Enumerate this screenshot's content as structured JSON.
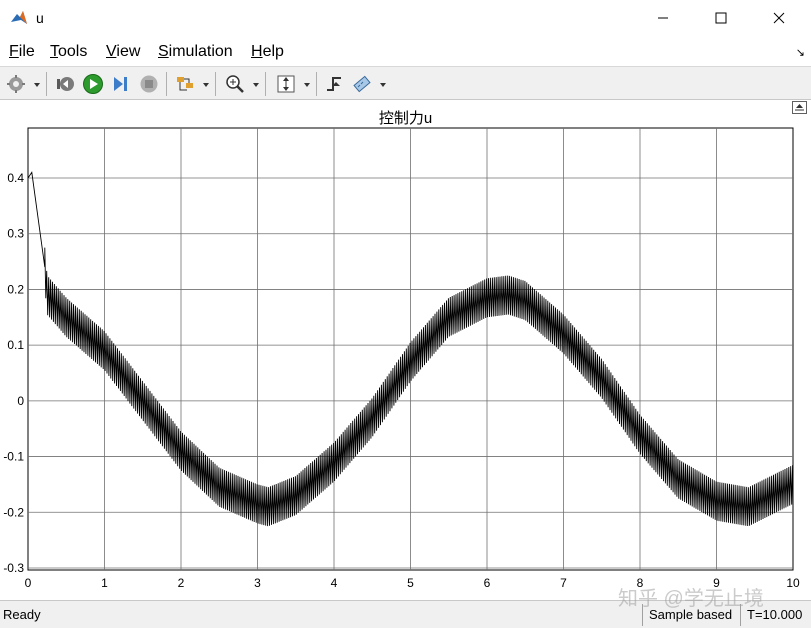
{
  "window": {
    "title": "u",
    "icon": "matlab-icon",
    "controls": [
      "minimize-icon",
      "maximize-icon",
      "close-icon"
    ]
  },
  "menu": {
    "items": [
      {
        "label": "File",
        "mnemonic": "F",
        "rest": "ile"
      },
      {
        "label": "Tools",
        "mnemonic": "T",
        "rest": "ools"
      },
      {
        "label": "View",
        "mnemonic": "V",
        "rest": "iew"
      },
      {
        "label": "Simulation",
        "mnemonic": "S",
        "rest": "imulation"
      },
      {
        "label": "Help",
        "mnemonic": "H",
        "rest": "elp"
      }
    ]
  },
  "toolbar": {
    "buttons": [
      "settings-icon",
      "step-back-icon",
      "run-icon",
      "step-forward-icon",
      "stop-icon",
      "signal-select-icon",
      "zoom-icon",
      "autoscale-icon",
      "triggers-icon",
      "cursor-measure-icon"
    ]
  },
  "chart_data": {
    "type": "line",
    "title": "控制力u",
    "xlabel": "",
    "ylabel": "",
    "xlim": [
      0,
      10
    ],
    "ylim": [
      -0.3,
      0.45
    ],
    "x_ticks": [
      "0",
      "1",
      "2",
      "3",
      "4",
      "5",
      "6",
      "7",
      "8",
      "9",
      "10"
    ],
    "y_ticks": [
      "0.4",
      "0.3",
      "0.2",
      "0.1",
      "0",
      "-0.1",
      "-0.2",
      "-0.3"
    ],
    "grid": true,
    "series": [
      {
        "color": "#000000",
        "description_points": {
          "x": [
            0.0,
            0.05,
            0.22,
            0.25,
            0.5,
            1.0,
            1.5,
            2.0,
            2.5,
            3.0,
            3.14,
            3.5,
            4.0,
            4.5,
            5.0,
            5.5,
            6.0,
            6.28,
            6.5,
            7.0,
            7.5,
            8.0,
            8.5,
            9.0,
            9.42,
            10.0
          ],
          "center": [
            0.4,
            0.39,
            0.24,
            0.19,
            0.15,
            0.09,
            0.0,
            -0.09,
            -0.155,
            -0.185,
            -0.19,
            -0.17,
            -0.11,
            -0.03,
            0.07,
            0.15,
            0.185,
            0.19,
            0.18,
            0.12,
            0.04,
            -0.06,
            -0.14,
            -0.18,
            -0.19,
            -0.15
          ],
          "oscillation_amplitude": 0.035
        }
      }
    ]
  },
  "plot": {
    "dock_icon": "undock-icon"
  },
  "status": {
    "ready": "Ready",
    "sample_mode": "Sample based",
    "time": "T=10.000"
  },
  "watermark": "知乎 @学无止境"
}
